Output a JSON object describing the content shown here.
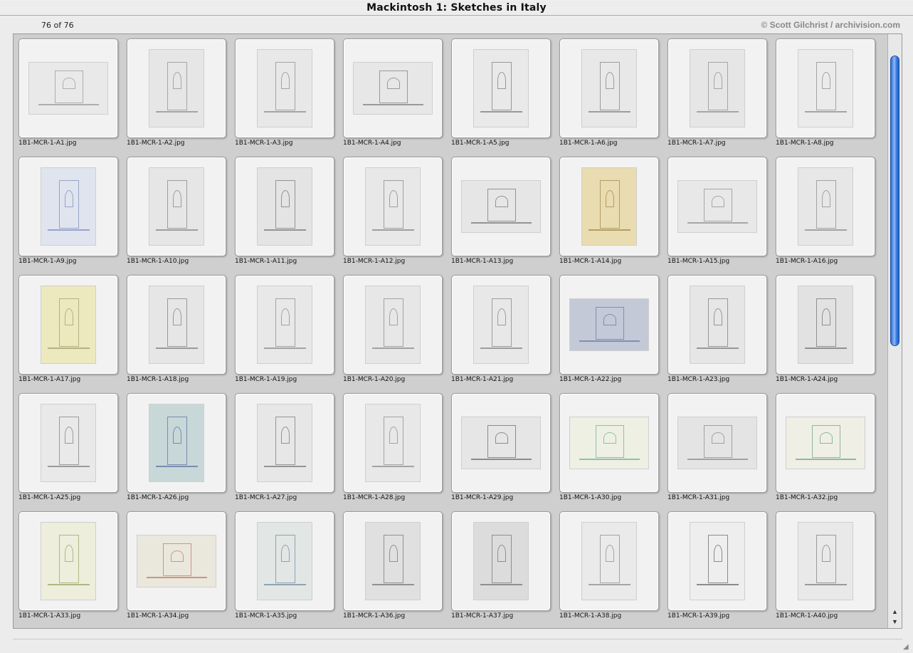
{
  "window": {
    "title": "Mackintosh 1: Sketches in Italy"
  },
  "info": {
    "count": "76 of 76",
    "copyright": "© Scott Gilchrist / archivision.com"
  },
  "thumbnails": [
    {
      "filename": "1B1-MCR-1-A1.jpg",
      "orientation": "landscape",
      "tint": "#e9e9e9",
      "ink": "#7d7d7d"
    },
    {
      "filename": "1B1-MCR-1-A2.jpg",
      "orientation": "portrait",
      "tint": "#e6e6e6",
      "ink": "#6f6f6f"
    },
    {
      "filename": "1B1-MCR-1-A3.jpg",
      "orientation": "portrait",
      "tint": "#e8e8e8",
      "ink": "#6a6a6a"
    },
    {
      "filename": "1B1-MCR-1-A4.jpg",
      "orientation": "landscape",
      "tint": "#e7e7e7",
      "ink": "#5a5a5a"
    },
    {
      "filename": "1B1-MCR-1-A5.jpg",
      "orientation": "portrait",
      "tint": "#e9e9e9",
      "ink": "#555555"
    },
    {
      "filename": "1B1-MCR-1-A6.jpg",
      "orientation": "portrait",
      "tint": "#e8e8e8",
      "ink": "#5c5c5c"
    },
    {
      "filename": "1B1-MCR-1-A7.jpg",
      "orientation": "portrait",
      "tint": "#e6e6e6",
      "ink": "#707070"
    },
    {
      "filename": "1B1-MCR-1-A8.jpg",
      "orientation": "portrait",
      "tint": "#ebebeb",
      "ink": "#6a6a6a"
    },
    {
      "filename": "1B1-MCR-1-A9.jpg",
      "orientation": "portrait",
      "tint": "#dfe4ee",
      "ink": "#5a6fa8"
    },
    {
      "filename": "1B1-MCR-1-A10.jpg",
      "orientation": "portrait",
      "tint": "#e6e6e6",
      "ink": "#606060"
    },
    {
      "filename": "1B1-MCR-1-A11.jpg",
      "orientation": "portrait",
      "tint": "#e4e4e4",
      "ink": "#505050"
    },
    {
      "filename": "1B1-MCR-1-A12.jpg",
      "orientation": "portrait",
      "tint": "#e8e8e8",
      "ink": "#606060"
    },
    {
      "filename": "1B1-MCR-1-A13.jpg",
      "orientation": "landscape",
      "tint": "#e6e6e6",
      "ink": "#4e4e4e"
    },
    {
      "filename": "1B1-MCR-1-A14.jpg",
      "orientation": "portrait",
      "tint": "#e8dcb0",
      "ink": "#8a6a2a"
    },
    {
      "filename": "1B1-MCR-1-A15.jpg",
      "orientation": "landscape",
      "tint": "#e8e8e8",
      "ink": "#707070"
    },
    {
      "filename": "1B1-MCR-1-A16.jpg",
      "orientation": "portrait",
      "tint": "#e7e7e7",
      "ink": "#6a6a6a"
    },
    {
      "filename": "1B1-MCR-1-A17.jpg",
      "orientation": "portrait",
      "tint": "#ece9bf",
      "ink": "#8a8250"
    },
    {
      "filename": "1B1-MCR-1-A18.jpg",
      "orientation": "portrait",
      "tint": "#e6e6e6",
      "ink": "#5a5a5a"
    },
    {
      "filename": "1B1-MCR-1-A19.jpg",
      "orientation": "portrait",
      "tint": "#e8e8e8",
      "ink": "#6a6a6a"
    },
    {
      "filename": "1B1-MCR-1-A20.jpg",
      "orientation": "portrait",
      "tint": "#e7e7e7",
      "ink": "#6a6a6a"
    },
    {
      "filename": "1B1-MCR-1-A21.jpg",
      "orientation": "portrait",
      "tint": "#e8e8e8",
      "ink": "#5e5e5e"
    },
    {
      "filename": "1B1-MCR-1-A22.jpg",
      "orientation": "landscape",
      "tint": "#c4c9d8",
      "ink": "#4a5c8c"
    },
    {
      "filename": "1B1-MCR-1-A23.jpg",
      "orientation": "portrait",
      "tint": "#e6e6e6",
      "ink": "#555555"
    },
    {
      "filename": "1B1-MCR-1-A24.jpg",
      "orientation": "portrait",
      "tint": "#e2e2e2",
      "ink": "#4a4a4a"
    },
    {
      "filename": "1B1-MCR-1-A25.jpg",
      "orientation": "portrait",
      "tint": "#e9e9e9",
      "ink": "#5a5a5a"
    },
    {
      "filename": "1B1-MCR-1-A26.jpg",
      "orientation": "portrait",
      "tint": "#c8d7d8",
      "ink": "#3a4f8a"
    },
    {
      "filename": "1B1-MCR-1-A27.jpg",
      "orientation": "portrait",
      "tint": "#e7e7e7",
      "ink": "#505050"
    },
    {
      "filename": "1B1-MCR-1-A28.jpg",
      "orientation": "portrait",
      "tint": "#e8e8e8",
      "ink": "#6a6a6a"
    },
    {
      "filename": "1B1-MCR-1-A29.jpg",
      "orientation": "landscape",
      "tint": "#e6e6e6",
      "ink": "#404040"
    },
    {
      "filename": "1B1-MCR-1-A30.jpg",
      "orientation": "landscape",
      "tint": "#eef0e4",
      "ink": "#3c9a7a"
    },
    {
      "filename": "1B1-MCR-1-A31.jpg",
      "orientation": "landscape",
      "tint": "#e4e4e4",
      "ink": "#6a6a6a"
    },
    {
      "filename": "1B1-MCR-1-A32.jpg",
      "orientation": "landscape",
      "tint": "#efefe6",
      "ink": "#3f8a5a"
    },
    {
      "filename": "1B1-MCR-1-A33.jpg",
      "orientation": "portrait",
      "tint": "#eeeedc",
      "ink": "#7a8a3a"
    },
    {
      "filename": "1B1-MCR-1-A34.jpg",
      "orientation": "landscape",
      "tint": "#eae8dc",
      "ink": "#b0503a"
    },
    {
      "filename": "1B1-MCR-1-A35.jpg",
      "orientation": "portrait",
      "tint": "#e2e6e4",
      "ink": "#4a6a8a"
    },
    {
      "filename": "1B1-MCR-1-A36.jpg",
      "orientation": "portrait",
      "tint": "#e0e0e0",
      "ink": "#505050"
    },
    {
      "filename": "1B1-MCR-1-A37.jpg",
      "orientation": "portrait",
      "tint": "#dcdcdc",
      "ink": "#505050"
    },
    {
      "filename": "1B1-MCR-1-A38.jpg",
      "orientation": "portrait",
      "tint": "#eaeaea",
      "ink": "#6a6a6a"
    },
    {
      "filename": "1B1-MCR-1-A39.jpg",
      "orientation": "portrait",
      "tint": "#eeeeee",
      "ink": "#3a3a3a"
    },
    {
      "filename": "1B1-MCR-1-A40.jpg",
      "orientation": "portrait",
      "tint": "#e9e9e9",
      "ink": "#5a5a5a"
    }
  ],
  "scrollbar": {
    "position": 0.0,
    "visible_fraction": 0.53
  }
}
